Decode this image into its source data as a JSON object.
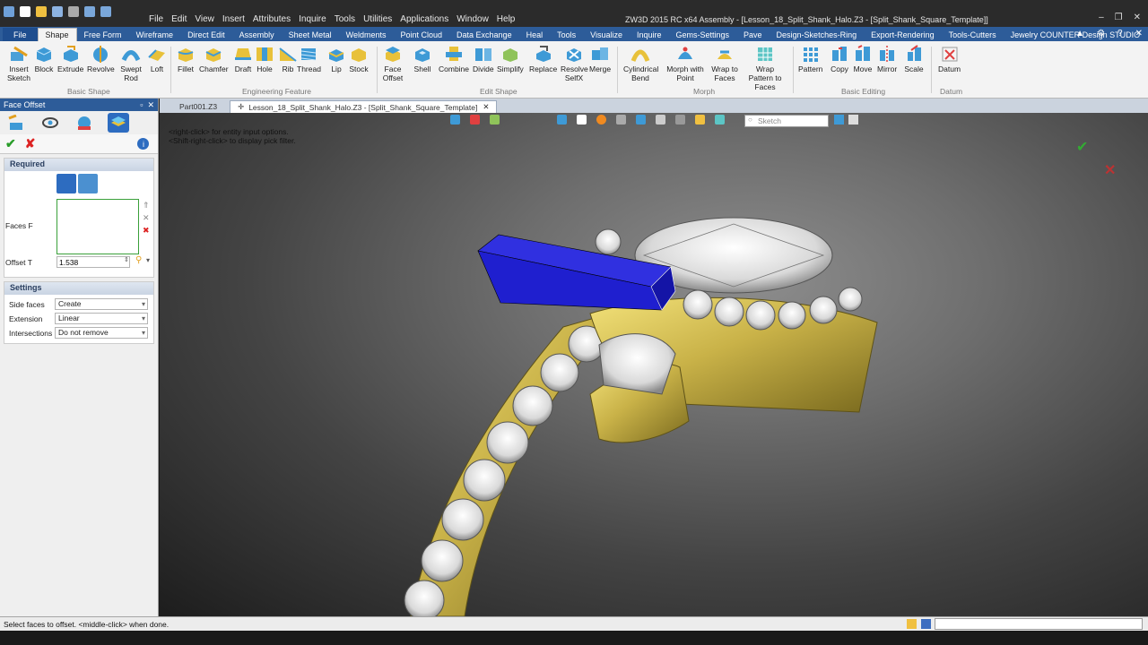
{
  "app": {
    "window_title": "ZW3D 2015 RC x64          Assembly - [Lesson_18_Split_Shank_Halo.Z3 - [Split_Shank_Square_Template]]"
  },
  "menu": [
    "File",
    "Edit",
    "View",
    "Insert",
    "Attributes",
    "Inquire",
    "Tools",
    "Utilities",
    "Applications",
    "Window",
    "Help"
  ],
  "ribbon_tabs": [
    "File",
    "Shape",
    "Free Form",
    "Wireframe",
    "Direct Edit",
    "Assembly",
    "Sheet Metal",
    "Weldments",
    "Point Cloud",
    "Data Exchange",
    "Heal",
    "Tools",
    "Visualize",
    "Inquire",
    "Gems-Settings",
    "Pave",
    "Design-Sketches-Ring",
    "Export-Rendering",
    "Tools-Cutters",
    "Jewelry COUNTER Design STUDIO"
  ],
  "active_tab": "Shape",
  "ribbon": {
    "basic_shape": {
      "label": "Basic Shape",
      "buttons": [
        "Insert Sketch",
        "Block",
        "Extrude",
        "Revolve",
        "Swept Rod",
        "Loft"
      ]
    },
    "engineering_feature": {
      "label": "Engineering Feature",
      "buttons": [
        "Fillet",
        "Chamfer",
        "Draft",
        "Hole",
        "Rib",
        "Thread",
        "Lip",
        "Stock"
      ]
    },
    "edit_shape": {
      "label": "Edit Shape",
      "buttons": [
        "Face Offset",
        "Shell",
        "Combine",
        "Divide",
        "Simplify",
        "Replace",
        "Resolve SelfX",
        "Merge"
      ]
    },
    "morph": {
      "label": "Morph",
      "buttons": [
        "Cylindrical Bend",
        "Morph with Point",
        "Wrap to Faces",
        "Wrap Pattern to Faces"
      ]
    },
    "basic_editing": {
      "label": "Basic Editing",
      "buttons": [
        "Pattern",
        "Copy",
        "Move",
        "Mirror",
        "Scale"
      ]
    },
    "datum": {
      "label": "Datum",
      "buttons": [
        "Datum"
      ]
    }
  },
  "panel": {
    "title": "Face Offset",
    "required": {
      "title": "Required",
      "faces_label": "Faces F",
      "offset_label": "Offset T",
      "offset_value": "1.538"
    },
    "settings": {
      "title": "Settings",
      "side_faces_label": "Side faces",
      "side_faces_value": "Create",
      "extension_label": "Extension",
      "extension_value": "Linear",
      "intersections_label": "Intersections",
      "intersections_value": "Do not remove"
    }
  },
  "doc_tabs": [
    "Part001.Z3",
    "Lesson_18_Split_Shank_Halo.Z3 - [Split_Shank_Square_Template]"
  ],
  "viewport": {
    "hint1": "<right-click> for entity input options.",
    "hint2": "<Shift-right-click> to display pick filter.",
    "search_placeholder": "Sketch"
  },
  "status": {
    "text": "Select faces to offset.  <middle-click> when done."
  },
  "colors": {
    "ribbon_blue": "#2d5c99",
    "gold": "#c8b244",
    "offset_face": "#1f1fcf"
  }
}
